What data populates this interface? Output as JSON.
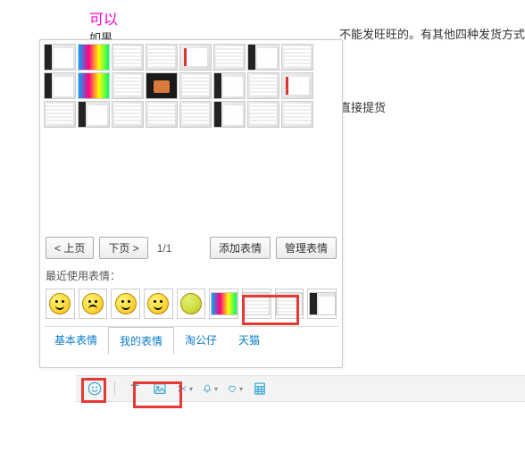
{
  "background": {
    "title": "可以",
    "partial_line": "如果",
    "right_line1": "不能发旺旺的。有其他四种发货方式",
    "right_line2": "直接提货"
  },
  "panel": {
    "prev": "< 上页",
    "next": "下页 >",
    "page": "1/1",
    "add": "添加表情",
    "manage": "管理表情",
    "recent_label": "最近使用表情：",
    "tabs": [
      "基本表情",
      "我的表情",
      "淘公仔",
      "天猫"
    ],
    "active_tab_index": 1
  },
  "toolbar": {
    "icons": [
      "smile-icon",
      "text-icon",
      "image-icon",
      "scissors-icon",
      "bell-icon",
      "heart-icon",
      "calculator-icon"
    ]
  }
}
